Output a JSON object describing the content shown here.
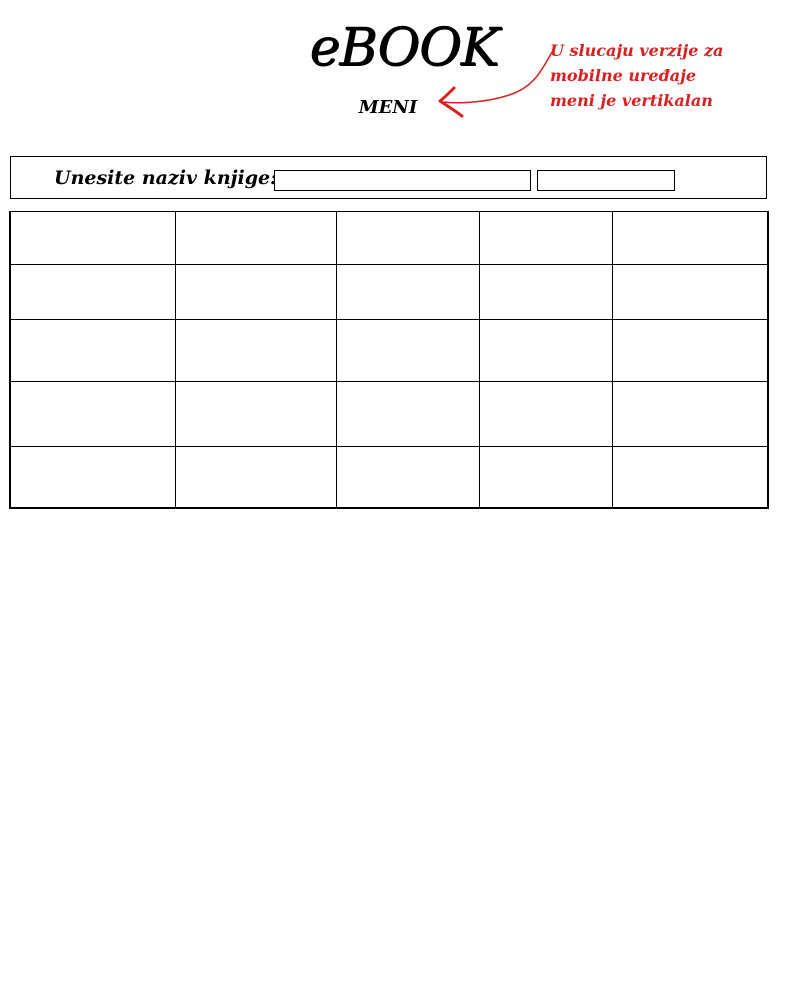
{
  "header": {
    "logo_text": "eBOOK",
    "menu_label": "MENI"
  },
  "annotation": {
    "text": "U slucaju verzije za\nmobilne uređaje\nmeni je vertikalan",
    "color": "#d82020",
    "icon": "arrow-icon"
  },
  "search": {
    "label": "Unesite naziv knjige:",
    "input_value": "",
    "input_placeholder": "",
    "button_label": ""
  },
  "grid": {
    "rows": 5,
    "columns": 5,
    "cells": [
      [
        "",
        "",
        "",
        "",
        ""
      ],
      [
        "",
        "",
        "",
        "",
        ""
      ],
      [
        "",
        "",
        "",
        "",
        ""
      ],
      [
        "",
        "",
        "",
        "",
        ""
      ],
      [
        "",
        "",
        "",
        "",
        ""
      ]
    ]
  }
}
